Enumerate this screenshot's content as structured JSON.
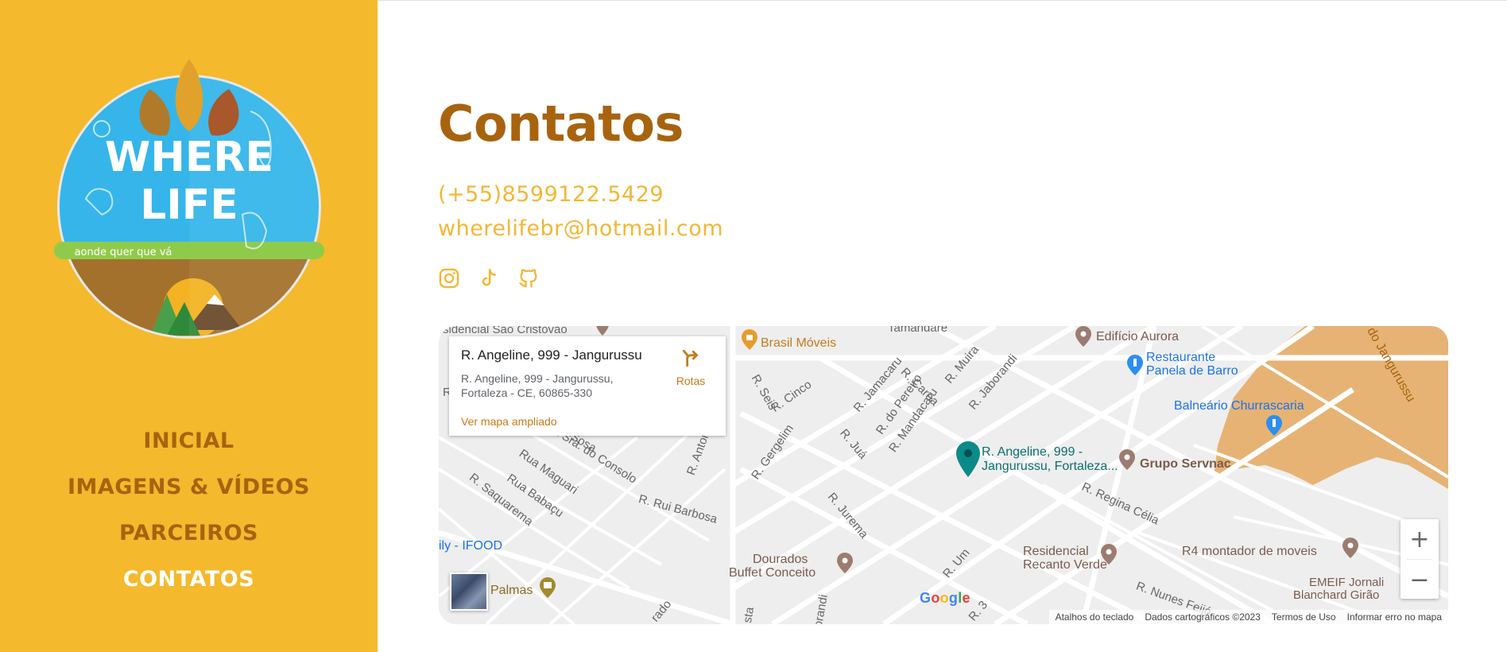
{
  "logo": {
    "line1": "WHERE",
    "line2": "LIFE",
    "tagline": "aonde quer que vá"
  },
  "nav": {
    "items": [
      {
        "label": "INICIAL",
        "active": false
      },
      {
        "label": "IMAGENS & VÍDEOS",
        "active": false
      },
      {
        "label": "PARCEIROS",
        "active": false
      },
      {
        "label": "CONTATOS",
        "active": true
      }
    ]
  },
  "main": {
    "title": "Contatos",
    "phone": "(+55)8599122.5429",
    "email": "wherelifebr@hotmail.com",
    "socials": [
      "instagram-icon",
      "tiktok-icon",
      "github-icon"
    ]
  },
  "colors": {
    "sidebar": "#f4b92c",
    "title": "#a8630f",
    "contact": "#f2b736",
    "nav_active": "#ffffff"
  },
  "map": {
    "info_card": {
      "title": "R. Angeline, 999 - Jangurussu",
      "address_line1": "R. Angeline, 999 - Jangurussu,",
      "address_line2": "Fortaleza - CE, 60865-330",
      "link": "Ver mapa ampliado",
      "directions": "Rotas"
    },
    "streets": [
      "sidencial São Cristovão",
      "R. Seis",
      "R. Cinco",
      "R. Jamacaru",
      "R. do Pereiro",
      "R. Caroa",
      "R. Muira",
      "R. Jaborandi",
      "R. Mandacaru",
      "R. Juá",
      "R. Gergelim",
      "R. Jurema",
      "R. Regina Célia",
      "R. Um",
      "R. 3",
      "R. Nunes Feijó",
      "Rua Maguari",
      "Rua Babaçu",
      "R. Saquarema",
      "R. Rui Barbosa",
      "R. Antonio h",
      "Nossa Sra. do Consolo",
      "Tamandaré",
      "do Jangurussu",
      "rado",
      "Sosa",
      "orandi",
      "sta",
      "R. S"
    ],
    "pois": {
      "brasil_moveis": "Brasil Móveis",
      "edificio_aurora": "Edifício Aurora",
      "restaurante_1": "Restaurante",
      "restaurante_2": "Panela de Barro",
      "balneario": "Balneário Churrascaria",
      "grupo_servnac": "Grupo Servnac",
      "selected_1": "R. Angeline, 999 -",
      "selected_2": "Jangurussu, Fortaleza...",
      "residencial_1": "Residencial",
      "residencial_2": "Recanto Verde",
      "r4": "R4 montador de moveis",
      "dourados_1": "Dourados",
      "dourados_2": "Buffet Conceito",
      "emeif_1": "EMEIF Jornali",
      "emeif_2": "Blanchard Girão",
      "ifood": "ily - IFOOD",
      "palmas": "Palmas"
    },
    "zoom_in": "+",
    "zoom_out": "−",
    "google": "Google",
    "footer": [
      "Atalhos do teclado",
      "Dados cartográficos ©2023",
      "Termos de Uso",
      "Informar erro no mapa"
    ]
  }
}
